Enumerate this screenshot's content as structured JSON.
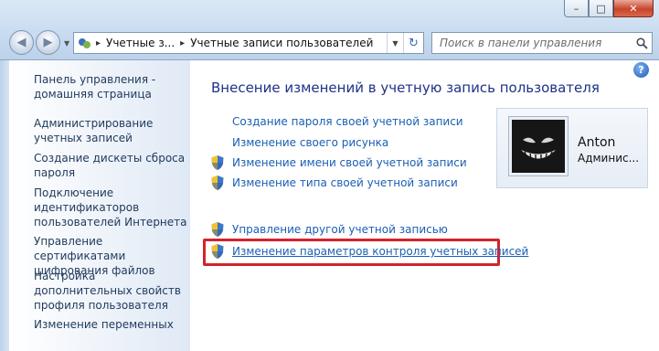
{
  "window": {
    "controls": {
      "minimize": "–",
      "maximize": "□",
      "close": "✕"
    }
  },
  "nav": {
    "back_icon": "back-arrow-icon",
    "forward_icon": "forward-arrow-icon"
  },
  "address": {
    "crumbs": [
      "Учетные з...",
      "Учетные записи пользователей"
    ],
    "separator": "▸"
  },
  "search": {
    "placeholder": "Поиск в панели управления"
  },
  "sidebar": {
    "items": [
      "Панель управления - домашняя страница",
      "Администрирование учетных записей",
      "Создание дискеты сброса пароля",
      "Подключение идентификаторов пользователей Интернета",
      "Управление сертификатами шифрования файлов",
      "Настройка дополнительных свойств профиля пользователя",
      "Изменение переменных"
    ]
  },
  "main": {
    "title": "Внесение изменений в учетную запись пользователя",
    "links": [
      {
        "label": "Создание пароля своей учетной записи",
        "shield": false
      },
      {
        "label": "Изменение своего рисунка",
        "shield": false
      },
      {
        "label": "Изменение имени своей учетной записи",
        "shield": true
      },
      {
        "label": "Изменение типа своей учетной записи",
        "shield": true
      },
      {
        "label": "Управление другой учетной записью",
        "shield": true
      },
      {
        "label": "Изменение параметров контроля учетных записей",
        "shield": true,
        "highlighted": true
      }
    ]
  },
  "user": {
    "name": "Anton",
    "role": "Админис..."
  },
  "colors": {
    "link": "#1a5fb4",
    "title": "#1e3287",
    "highlight": "#d3232b"
  }
}
